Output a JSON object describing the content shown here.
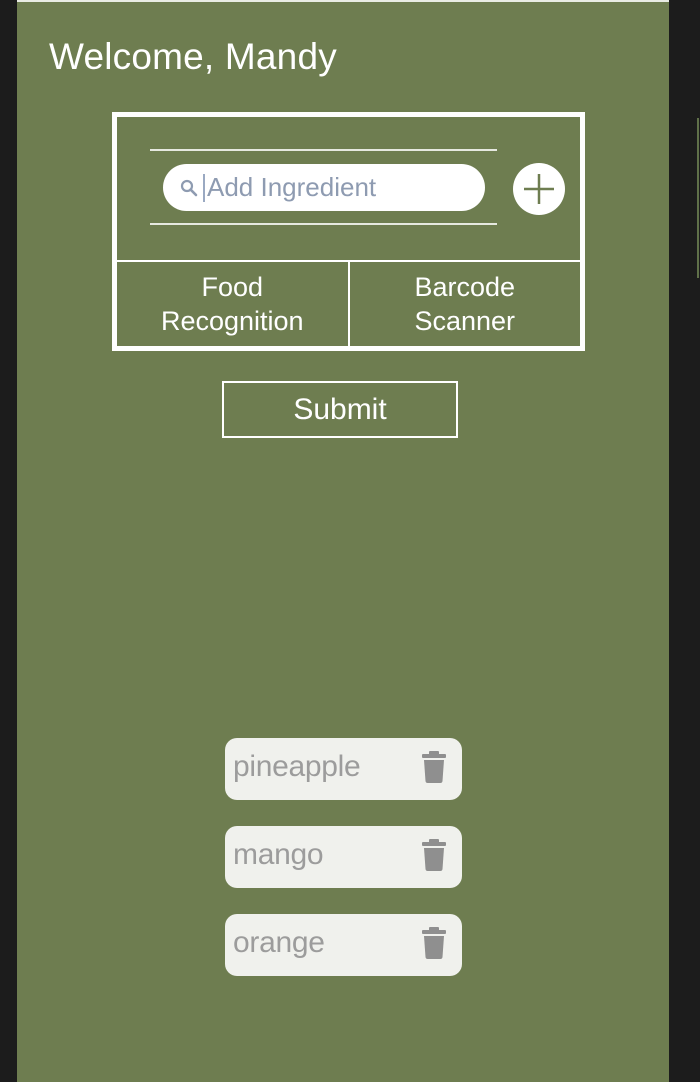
{
  "header": {
    "welcome": "Welcome, Mandy"
  },
  "search": {
    "placeholder": "Add Ingredient",
    "value": ""
  },
  "icons": {
    "search": "search-icon",
    "add": "plus-icon",
    "delete": "trash-icon"
  },
  "options": {
    "food_recognition": [
      "Food",
      "Recognition"
    ],
    "barcode_scanner": [
      "Barcode",
      "Scanner"
    ]
  },
  "actions": {
    "submit_label": "Submit"
  },
  "ingredients": [
    {
      "name": "pineapple"
    },
    {
      "name": "mango"
    },
    {
      "name": "orange"
    }
  ],
  "colors": {
    "background": "#6e7d50",
    "foreground": "#ffffff",
    "chip": "#f0f1ed",
    "chip_text": "#9c9c9c",
    "placeholder": "#8e9bb1"
  }
}
